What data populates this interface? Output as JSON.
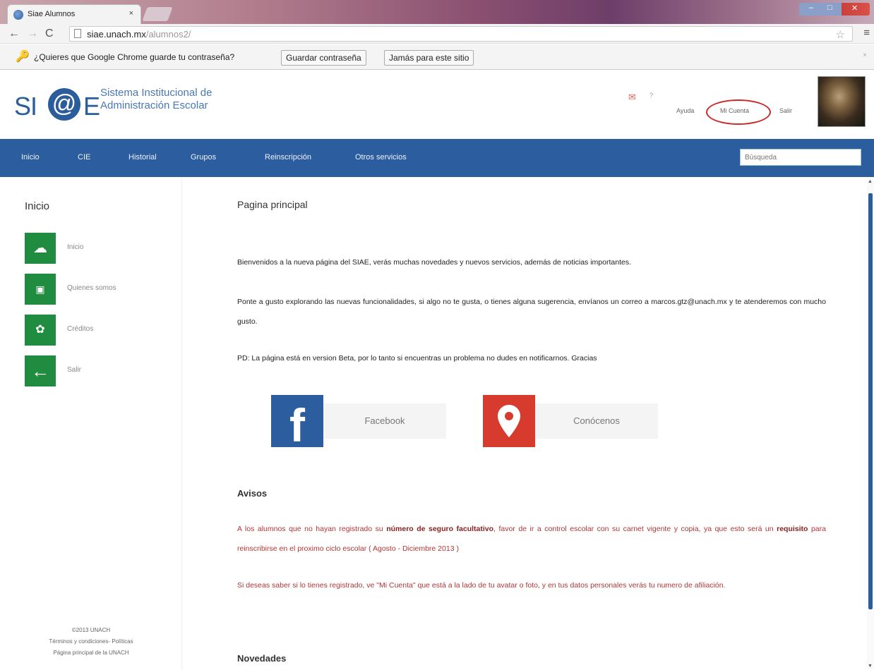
{
  "browser": {
    "tab_title": "Siae Alumnos",
    "tab_close": "×",
    "url_host": "siae.unach.mx",
    "url_path": "/alumnos2/",
    "infobar_message": "¿Quieres que Google Chrome guarde tu contraseña?",
    "save_password": "Guardar contraseña",
    "never_for_site": "Jamás para este sitio",
    "infobar_close": "×"
  },
  "header": {
    "logo_si": "SI",
    "logo_at": "@",
    "logo_e": "E",
    "system_name": "Sistema Institucional de Administración Escolar",
    "mail_count": "?",
    "links": {
      "help": "Ayuda",
      "account": "Mi Cuenta",
      "logout": "Salir"
    }
  },
  "nav": {
    "items": [
      "Inicio",
      "CIE",
      "Historial",
      "Grupos",
      "Reinscripción",
      "Otros servicios"
    ],
    "search_placeholder": "Búsqueda"
  },
  "sidebar": {
    "title": "Inicio",
    "items": [
      {
        "label": "Inicio",
        "icon": "cloud-icon"
      },
      {
        "label": "Quienes somos",
        "icon": "camera-icon"
      },
      {
        "label": "Créditos",
        "icon": "handshake-icon"
      },
      {
        "label": "Salir",
        "icon": "arrow-left-icon"
      }
    ],
    "footer": [
      "©2013 UNACH",
      "Términos y condiciones- Políticas",
      "Página principal de la UNACH"
    ]
  },
  "main": {
    "title": "Pagina principal",
    "p1": "Bienvenidos a la nueva página del SIAE, verás muchas novedades y nuevos servicios, además de noticias importantes.",
    "p2": "Ponte a gusto explorando las nuevas funcionalidades, si algo no te gusta, o tienes alguna sugerencia, envíanos un correo a marcos.gtz@unach.mx y te atenderemos con mucho gusto.",
    "p3": "PD: La página está en version Beta, por lo tanto si encuentras un problema no dudes en notificarnos. Gracias",
    "facebook": "Facebook",
    "facebook_letter": "f",
    "conocenos": "Conócenos",
    "avisos_title": "Avisos",
    "aviso1_a": "A los alumnos que no hayan registrado su ",
    "aviso1_b": "número de seguro facultativo",
    "aviso1_c": ", favor de ir a control escolar con su carnet vigente y copia, ya que esto será un ",
    "aviso1_d": "requisito",
    "aviso1_e": " para reinscribirse en el proximo ciclo escolar ( Agosto - Diciembre 2013 )",
    "aviso2": "Si deseas saber si lo tienes registrado, ve \"Mi Cuenta\" que está a la lado de tu avatar o foto, y en tus datos personales verás tu numero de afiliación.",
    "novedades_title": "Novedades"
  },
  "colors": {
    "brand_blue": "#2c5d9f",
    "sidebar_green": "#1f8c3f",
    "notice_red": "#b03535",
    "highlight_circle": "#c92a2a"
  }
}
